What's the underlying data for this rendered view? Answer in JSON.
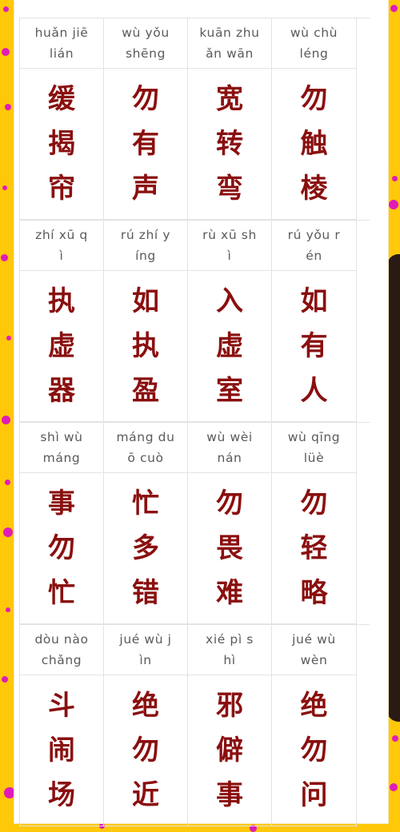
{
  "groups": [
    {
      "pinyin": [
        "huǎn  jiē\nlián",
        "wù  yǒu\nshēng",
        "kuān  zhu\nǎn  wān",
        "wù  chù\nléng"
      ],
      "chars": [
        [
          "缓",
          "揭",
          "帘"
        ],
        [
          "勿",
          "有",
          "声"
        ],
        [
          "宽",
          "转",
          "弯"
        ],
        [
          "勿",
          "触",
          "棱"
        ]
      ]
    },
    {
      "pinyin": [
        "zhí  xū  q\nì",
        "rú  zhí  y\níng",
        "rù  xū  sh\nì",
        "rú  yǒu  r\nén"
      ],
      "chars": [
        [
          "执",
          "虚",
          "器"
        ],
        [
          "如",
          "执",
          "盈"
        ],
        [
          "入",
          "虚",
          "室"
        ],
        [
          "如",
          "有",
          "人"
        ]
      ]
    },
    {
      "pinyin": [
        "shì  wù\nmáng",
        "máng  du\nō  cuò",
        "wù  wèi\nnán",
        "wù  qīng\nlüè"
      ],
      "chars": [
        [
          "事",
          "勿",
          "忙"
        ],
        [
          "忙",
          "多",
          "错"
        ],
        [
          "勿",
          "畏",
          "难"
        ],
        [
          "勿",
          "轻",
          "略"
        ]
      ]
    },
    {
      "pinyin": [
        "dòu  nào\nchǎng",
        "jué  wù  j\nìn",
        "xié  pì  s\nhì",
        "jué  wù\nwèn"
      ],
      "chars": [
        [
          "斗",
          "闹",
          "场"
        ],
        [
          "绝",
          "勿",
          "近"
        ],
        [
          "邪",
          "僻",
          "事"
        ],
        [
          "绝",
          "勿",
          "问"
        ]
      ]
    }
  ],
  "colors": {
    "background": "#ffc808",
    "dots": "#e01cb8",
    "hanzi": "#8a0f0f",
    "pinyin": "#5a5a5a"
  }
}
